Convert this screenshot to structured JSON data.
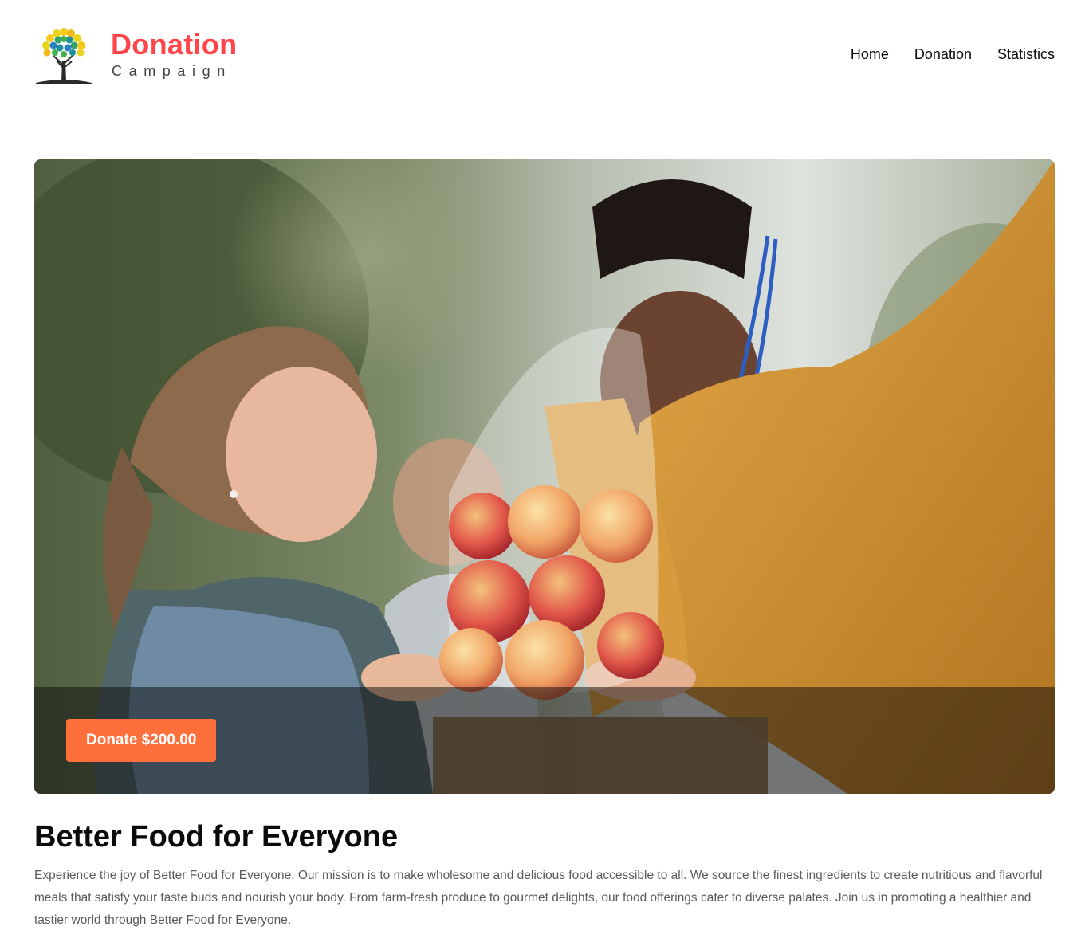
{
  "brand": {
    "title": "Donation",
    "subtitle": "Campaign",
    "title_color": "#ff444a",
    "logo_icon": "tree-icon"
  },
  "nav": {
    "items": [
      {
        "label": "Home"
      },
      {
        "label": "Donation"
      },
      {
        "label": "Statistics"
      }
    ]
  },
  "hero": {
    "image": "food-donation-photo",
    "donate_label": "Donate $200.00",
    "button_color": "#ff6f3c"
  },
  "campaign": {
    "title": "Better Food for Everyone",
    "description": "Experience the joy of Better Food for Everyone. Our mission is to make wholesome and delicious food accessible to all. We source the finest ingredients to create nutritious and flavorful meals that satisfy your taste buds and nourish your body. From farm-fresh produce to gourmet delights, our food offerings cater to diverse palates. Join us in promoting a healthier and tastier world through Better Food for Everyone."
  }
}
